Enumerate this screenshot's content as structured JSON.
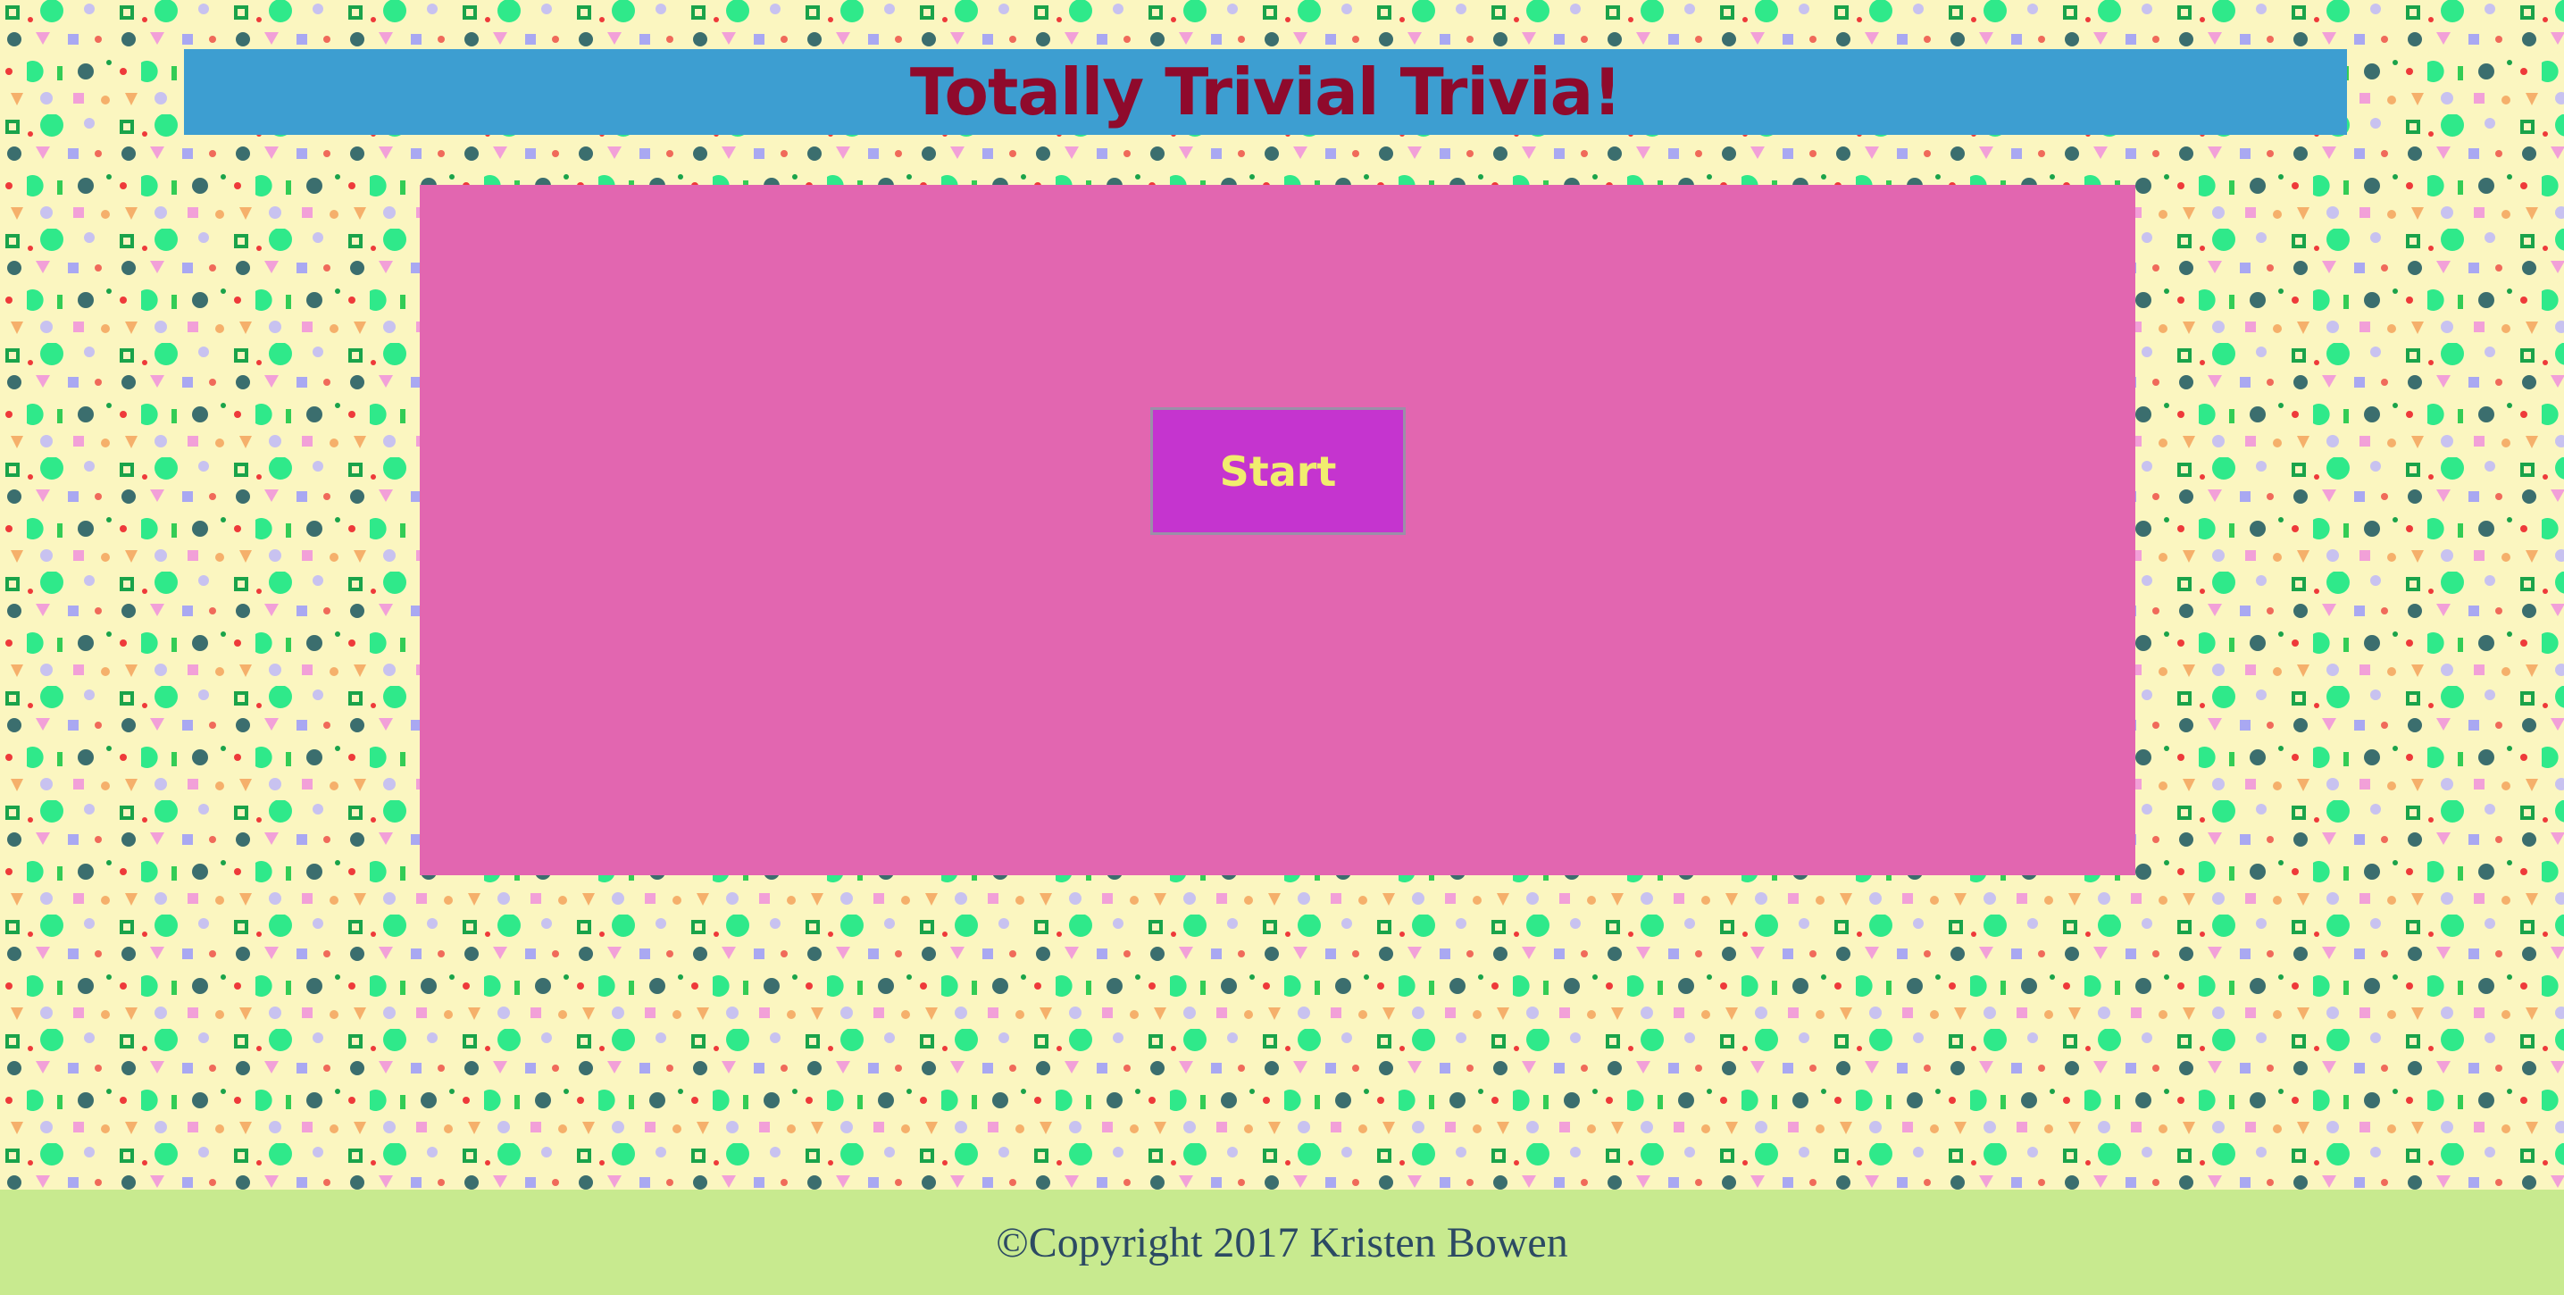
{
  "header": {
    "title": "Totally Trivial Trivia!"
  },
  "game": {
    "start_label": "Start"
  },
  "footer": {
    "copyright": "©Copyright 2017 Kristen Bowen"
  },
  "colors": {
    "background": "#fbf6c0",
    "header_bar": "#3d9ed1",
    "title_text": "#8f0a2c",
    "panel": "#e266b0",
    "button": "#c534cf",
    "button_text": "#f1ed6e",
    "footer_bar": "#c8ea8f",
    "footer_text": "#2c4a63"
  }
}
